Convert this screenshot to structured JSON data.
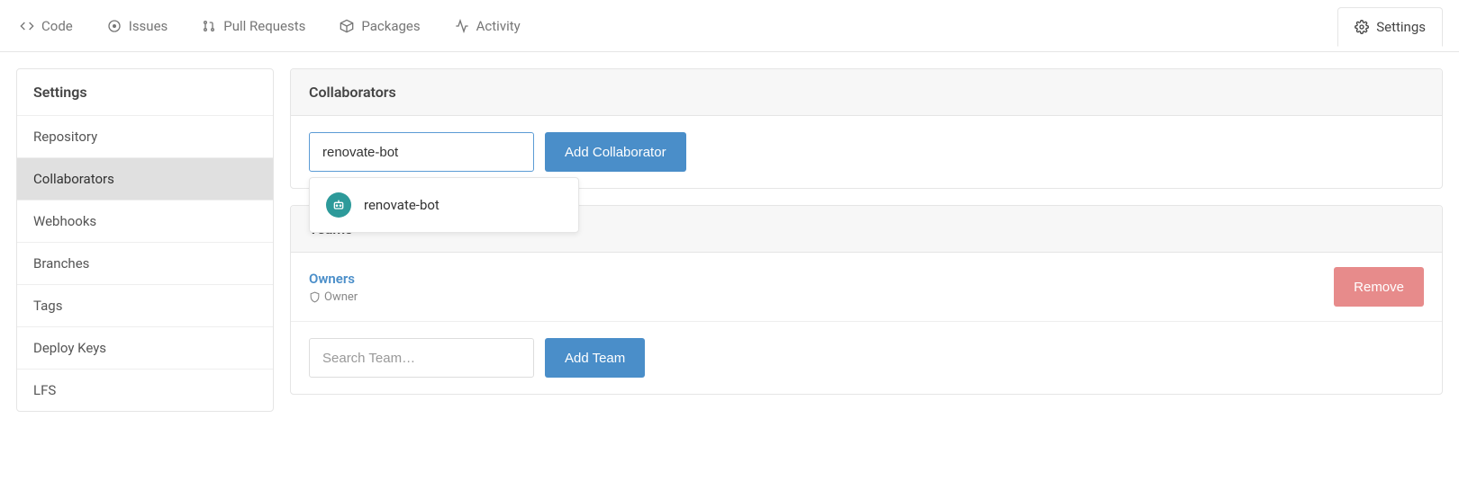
{
  "topbar": {
    "tabs": [
      {
        "label": "Code"
      },
      {
        "label": "Issues"
      },
      {
        "label": "Pull Requests"
      },
      {
        "label": "Packages"
      },
      {
        "label": "Activity"
      }
    ],
    "settings_label": "Settings"
  },
  "sidebar": {
    "title": "Settings",
    "items": [
      {
        "label": "Repository"
      },
      {
        "label": "Collaborators"
      },
      {
        "label": "Webhooks"
      },
      {
        "label": "Branches"
      },
      {
        "label": "Tags"
      },
      {
        "label": "Deploy Keys"
      },
      {
        "label": "LFS"
      }
    ]
  },
  "collaborators": {
    "header": "Collaborators",
    "search_value": "renovate-bot",
    "add_button": "Add Collaborator",
    "suggestion_label": "renovate-bot"
  },
  "teams": {
    "header": "Teams",
    "team_name": "Owners",
    "team_role": "Owner",
    "remove_label": "Remove",
    "search_placeholder": "Search Team…",
    "add_button": "Add Team"
  }
}
